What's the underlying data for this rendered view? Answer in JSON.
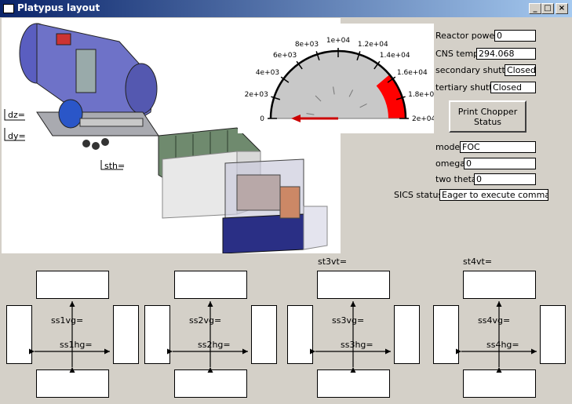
{
  "window": {
    "title": "Platypus layout",
    "min_glyph": "_",
    "max_glyph": "□",
    "close_glyph": "×"
  },
  "drawing": {
    "dz_label": "dz=",
    "dy_label": "dy=",
    "sth_label": "sth="
  },
  "gauge": {
    "min": 0,
    "max": 20000,
    "value": 0,
    "red_zone_start": 15500,
    "tick_labels": [
      "0",
      "2e+03",
      "4e+03",
      "6e+03",
      "8e+03",
      "1e+04",
      "1.2e+04",
      "1.4e+04",
      "1.6e+04",
      "1.8e+04",
      "2e+04"
    ],
    "needle_color": "#cc0000",
    "zone_color": "#ff0000"
  },
  "status": {
    "reactor_power_label": "Reactor power",
    "reactor_power_value": "0",
    "cns_temp_label": "CNS temp",
    "cns_temp_value": "294.068",
    "secondary_shutter_label": "secondary shutter",
    "secondary_shutter_value": "Closed",
    "tertiary_shutter_label": "tertiary shutter",
    "tertiary_shutter_value": "Closed",
    "print_chopper_label_1": "Print Chopper",
    "print_chopper_label_2": "Status",
    "mode_label": "mode",
    "mode_value": "FOC",
    "omega_label": "omega",
    "omega_value": "0",
    "two_theta_label": "two theta",
    "two_theta_value": "0",
    "sics_status_label": "SICS status",
    "sics_status_value": "Eager to execute commands"
  },
  "slits": {
    "st3vt_label": "st3vt=",
    "st4vt_label": "st4vt=",
    "items": [
      {
        "vg_label": "ss1vg=",
        "hg_label": "ss1hg="
      },
      {
        "vg_label": "ss2vg=",
        "hg_label": "ss2hg="
      },
      {
        "vg_label": "ss3vg=",
        "hg_label": "ss3hg="
      },
      {
        "vg_label": "ss4vg=",
        "hg_label": "ss4hg="
      }
    ]
  }
}
